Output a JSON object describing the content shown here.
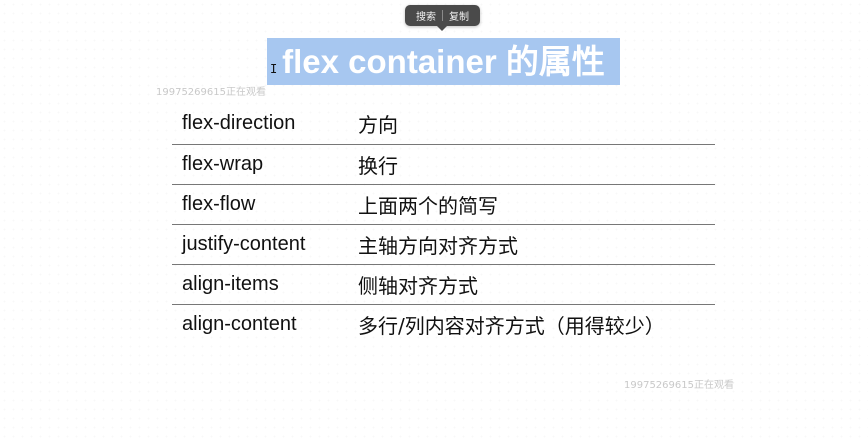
{
  "popup": {
    "search": "搜索",
    "copy": "复制"
  },
  "title": "flex container 的属性",
  "cursor_icon": "text-cursor-icon",
  "watermark": "19975269615正在观看",
  "table": {
    "rows": [
      {
        "property": "flex-direction",
        "description": "方向"
      },
      {
        "property": "flex-wrap",
        "description": "换行"
      },
      {
        "property": "flex-flow",
        "description": "上面两个的简写"
      },
      {
        "property": "justify-content",
        "description": "主轴方向对齐方式"
      },
      {
        "property": "align-items",
        "description": "侧轴对齐方式"
      },
      {
        "property": "align-content",
        "description": "多行/列内容对齐方式（用得较少）"
      }
    ]
  },
  "colors": {
    "selection": "#a7c7f0",
    "popup_bg": "#4a4a4a",
    "divider": "#777777"
  }
}
